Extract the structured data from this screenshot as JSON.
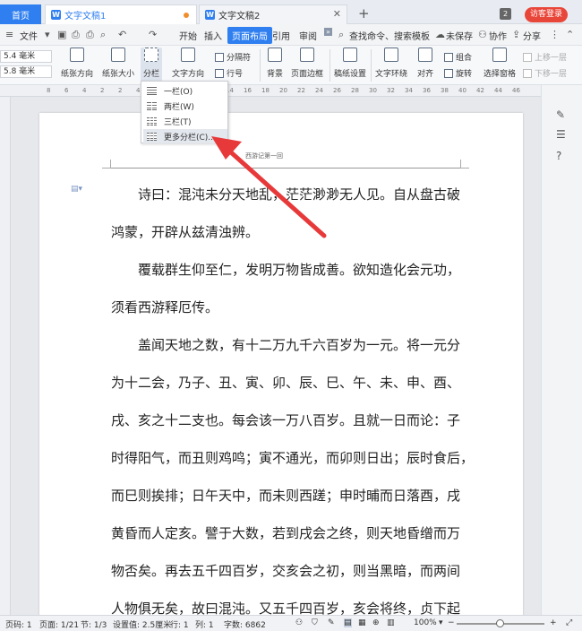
{
  "tabs": {
    "home": "首页",
    "doc1": "文字文稿1",
    "doc2": "文字文稿2",
    "badge": "2",
    "login": "访客登录"
  },
  "menu": {
    "file": "文件",
    "items": [
      "开始",
      "插入",
      "页面布局",
      "引用",
      "审阅"
    ],
    "search": "查找命令、搜索模板",
    "unsaved": "未保存",
    "collab": "协作",
    "share": "分享"
  },
  "ribbon": {
    "margin_top": "5.4 毫米",
    "margin_bottom": "5.8 毫米",
    "orientation": "纸张方向",
    "size": "纸张大小",
    "columns": "分栏",
    "text_direction": "文字方向",
    "breaks": "分隔符",
    "line_numbers": "行号",
    "background": "背景",
    "page_border": "页面边框",
    "draft_settings": "稿纸设置",
    "text_wrap": "文字环绕",
    "align": "对齐",
    "group": "组合",
    "rotate": "旋转",
    "selection_pane": "选择窗格",
    "bring_forward": "上移一层",
    "send_backward": "下移一层"
  },
  "dropdown": {
    "items": [
      "一栏(O)",
      "两栏(W)",
      "三栏(T)",
      "更多分栏(C)..."
    ]
  },
  "document": {
    "header": "西游记第一回",
    "paragraphs": [
      [
        "诗曰：混沌未分天地乱，茫茫渺渺无人见。自从盘古破",
        "鸿蒙，开辟从兹清浊辨。"
      ],
      [
        "覆载群生仰至仁，发明万物皆成善。欲知造化会元功，",
        "须看西游释厄传。"
      ],
      [
        "盖闻天地之数，有十二万九千六百岁为一元。将一元分",
        "为十二会，乃子、丑、寅、卯、辰、巳、午、未、申、酉、",
        "戌、亥之十二支也。每会该一万八百岁。且就一日而论：子",
        "时得阳气，而丑则鸡鸣；寅不通光，而卯则日出；辰时食后，",
        "而巳则挨排；日午天中，而未则西蹉；申时晡而日落酉，戌",
        "黄昏而人定亥。譬于大数，若到戌会之终，则天地昏缯而万",
        "物否矣。再去五千四百岁，交亥会之初，则当黑暗，而两间",
        "人物俱无矣，故曰混沌。又五千四百岁，亥会将终，贞下起"
      ]
    ]
  },
  "status": {
    "page_code": "页码: 1",
    "pages": "页面: 1/21",
    "section": "节: 1/3",
    "setting": "设置值: 2.5厘米",
    "row": "行: 1",
    "col": "列: 1",
    "word_count": "字数: 6862",
    "zoom": "100%"
  },
  "ruler_ticks": [
    "8",
    "6",
    "4",
    "2",
    "2",
    "4",
    "6",
    "8",
    "10",
    "12",
    "14",
    "16",
    "18",
    "20",
    "22",
    "24",
    "26",
    "28",
    "30",
    "32",
    "34",
    "36",
    "38",
    "40",
    "42",
    "44",
    "46"
  ],
  "colors": {
    "accent": "#2f7ff0",
    "login": "#e9463a",
    "arrow": "#e8393a"
  }
}
